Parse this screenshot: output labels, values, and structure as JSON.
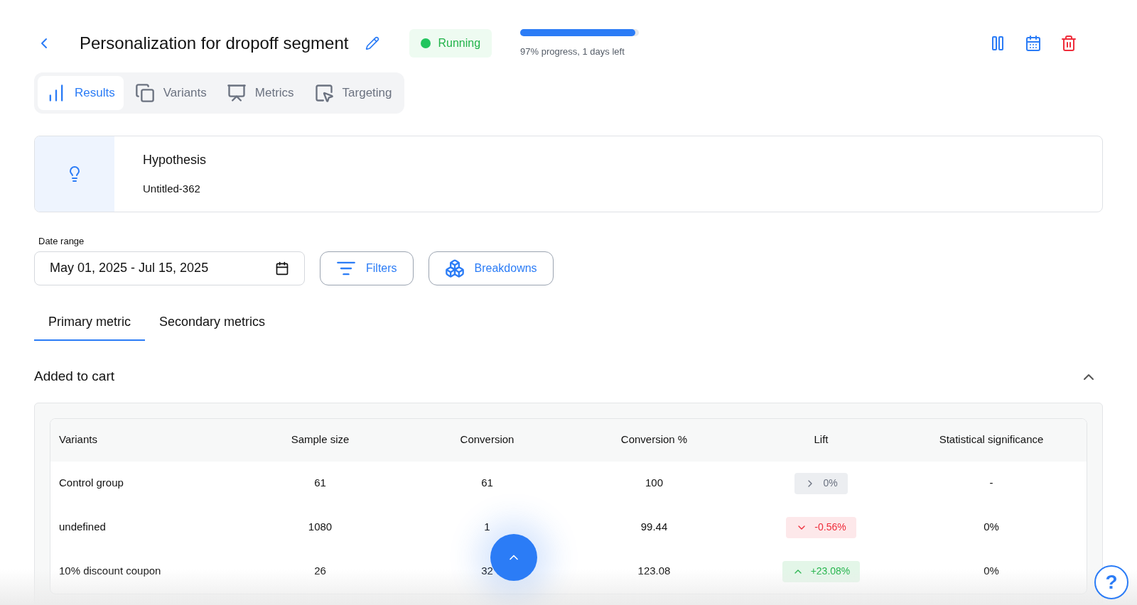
{
  "header": {
    "title": "Personalization for dropoff segment",
    "status": {
      "label": "Running",
      "color": "#22c55e"
    },
    "progress": {
      "level": 0.97,
      "caption": "97% progress, 1 days left"
    }
  },
  "tabs": [
    {
      "label": "Results",
      "kind": "chart",
      "selected": true
    },
    {
      "label": "Variants",
      "kind": "variants",
      "selected": false
    },
    {
      "label": "Metrics",
      "kind": "board",
      "selected": false
    },
    {
      "label": "Targeting",
      "kind": "cursor",
      "selected": false
    }
  ],
  "hypothesis": {
    "title": "Hypothesis",
    "text": "Untitled-362"
  },
  "date_range": {
    "label": "Date range",
    "value": "May 01, 2025 - Jul 15, 2025"
  },
  "buttons": [
    {
      "label": "Filters",
      "kind": "filter"
    },
    {
      "label": "Breakdowns",
      "kind": "cubes"
    }
  ],
  "metric_tabs": [
    {
      "label": "Primary metric",
      "selected": true
    },
    {
      "label": "Secondary metrics",
      "selected": false
    }
  ],
  "section": {
    "title": "Added to cart",
    "expanded": true
  },
  "table": {
    "columns": [
      "Variants",
      "Sample size",
      "Conversion",
      "Conversion %",
      "Lift",
      "Statistical significance"
    ],
    "rows": [
      {
        "variant": "Control group",
        "sample_size": "61",
        "conversion": "61",
        "conversion_pct": "100",
        "lift": {
          "kind": "neutral",
          "value": "0%"
        },
        "significance": "-"
      },
      {
        "variant": "undefined",
        "sample_size": "1080",
        "conversion": "1",
        "conversion_pct": "99.44",
        "lift": {
          "kind": "down",
          "value": "-0.56%"
        },
        "significance": "0%"
      },
      {
        "variant": "10% discount coupon",
        "sample_size": "26",
        "conversion": "32",
        "conversion_pct": "123.08",
        "lift": {
          "kind": "up",
          "value": "+23.08%"
        },
        "significance": "0%"
      }
    ]
  },
  "help": {
    "label": "?"
  }
}
